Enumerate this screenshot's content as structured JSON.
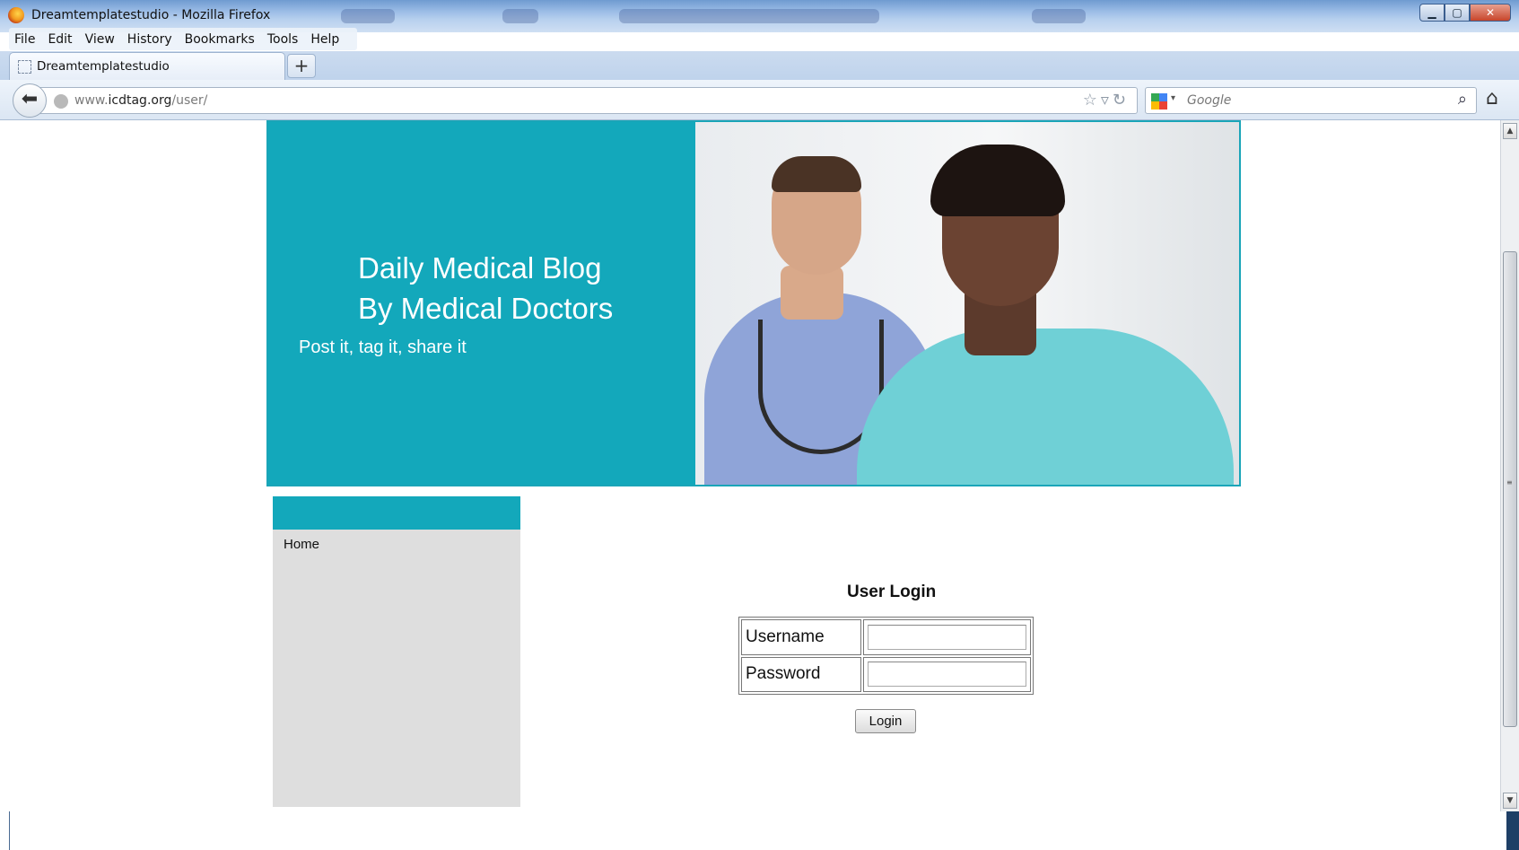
{
  "window": {
    "title": "Dreamtemplatestudio - Mozilla Firefox"
  },
  "menu": {
    "items": [
      "File",
      "Edit",
      "View",
      "History",
      "Bookmarks",
      "Tools",
      "Help"
    ]
  },
  "tab": {
    "label": "Dreamtemplatestudio",
    "new_tab": "+"
  },
  "address": {
    "domain_prefix": "www.",
    "domain": "icdtag.org",
    "path": "/user/"
  },
  "search": {
    "placeholder": "Google"
  },
  "banner": {
    "title_line1": "Daily Medical Blog",
    "title_line2": "By Medical Doctors",
    "tagline": "Post it, tag it, share it"
  },
  "sidebar": {
    "link": "Home"
  },
  "login": {
    "title": "User Login",
    "username_label": "Username",
    "password_label": "Password",
    "username_value": "",
    "password_value": "",
    "button": "Login"
  },
  "colors": {
    "accent": "#13a8bb",
    "sidebar_bg": "#dedede"
  }
}
